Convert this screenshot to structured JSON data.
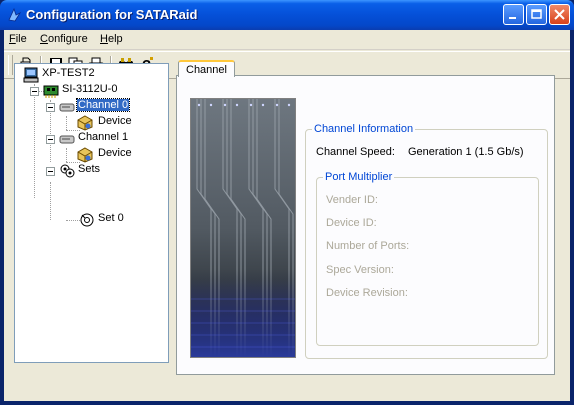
{
  "window": {
    "title": "Configuration for SATARaid"
  },
  "menu": [
    {
      "label": "File",
      "mnemonic": "F",
      "rest": "ile"
    },
    {
      "label": "Configure",
      "mnemonic": "C",
      "rest": "onfigure"
    },
    {
      "label": "Help",
      "mnemonic": "H",
      "rest": "elp"
    }
  ],
  "toolbar": {
    "buttons": [
      "open-icon",
      "save-icon",
      "copy-icon",
      "print-icon",
      "binoculars-icon",
      "help-icon"
    ]
  },
  "tree": {
    "root": "XP-TEST2",
    "controller": "SI-3112U-0",
    "channel0": "Channel 0",
    "device0": "Device",
    "channel1": "Channel 1",
    "device1": "Device",
    "sets": "Sets",
    "set0": "Set 0"
  },
  "tabs": {
    "active": "Channel"
  },
  "channel_info": {
    "group_title": "Channel Information",
    "speed_label": "Channel Speed:",
    "speed_value": "Generation 1 (1.5 Gb/s)"
  },
  "port_multiplier": {
    "group_title": "Port Multiplier",
    "vendor_id": "Vender ID:",
    "device_id": "Device ID:",
    "num_ports": "Number of Ports:",
    "spec_version": "Spec Version:",
    "device_revision": "Device Revision:"
  },
  "colors": {
    "titlebar": "#0550d8",
    "selection": "#316ac5",
    "group_title": "#0046d5"
  }
}
